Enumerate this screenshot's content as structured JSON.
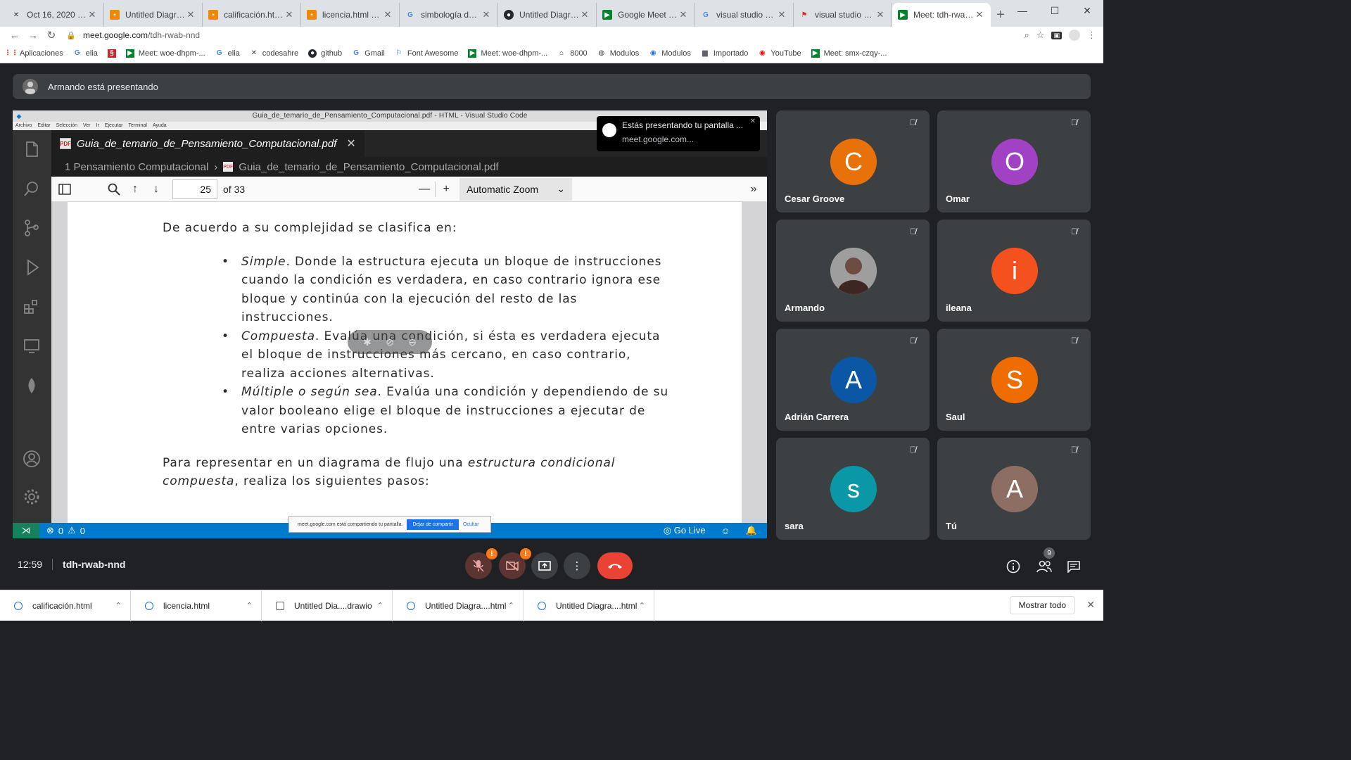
{
  "browser": {
    "tabs": [
      {
        "label": "Oct 16, 2020 - Co",
        "icon": "codesandbox-icon"
      },
      {
        "label": "Untitled Diagram.d",
        "icon": "drawio-icon"
      },
      {
        "label": "calificación.html -",
        "icon": "drawio-icon"
      },
      {
        "label": "licencia.html - diag",
        "icon": "drawio-icon"
      },
      {
        "label": "simbología de diag",
        "icon": "google-icon"
      },
      {
        "label": "Untitled Diagram.d",
        "icon": "github-icon"
      },
      {
        "label": "Google Meet (ante",
        "icon": "meet-icon"
      },
      {
        "label": "visual studio code",
        "icon": "google-icon"
      },
      {
        "label": "visual studio - Una",
        "icon": "bookmark-icon"
      },
      {
        "label": "Meet: tdh-rwab-nn",
        "icon": "meet-icon"
      }
    ],
    "url_host": "meet.google.com",
    "url_path": "/tdh-rwab-nnd",
    "bookmarks": [
      {
        "label": "Aplicaciones",
        "icon": "apps-grid-icon"
      },
      {
        "label": "elia",
        "icon": "google-icon"
      },
      {
        "label": "",
        "icon": "gov-icon"
      },
      {
        "label": "Meet: woe-dhpm-...",
        "icon": "meet-icon"
      },
      {
        "label": "elia",
        "icon": "google-icon"
      },
      {
        "label": "codesahre",
        "icon": "codeshare-icon"
      },
      {
        "label": "github",
        "icon": "github-icon"
      },
      {
        "label": "Gmail",
        "icon": "google-icon"
      },
      {
        "label": "Font Awesome",
        "icon": "flag-icon"
      },
      {
        "label": "Meet: woe-dhpm-...",
        "icon": "meet-icon"
      },
      {
        "label": "8000",
        "icon": "home-icon"
      },
      {
        "label": "Modulos",
        "icon": "globe-icon"
      },
      {
        "label": "Modulos",
        "icon": "edge-icon"
      },
      {
        "label": "Importado",
        "icon": "folder-icon"
      },
      {
        "label": "YouTube",
        "icon": "youtube-icon"
      },
      {
        "label": "Meet: smx-czqy-...",
        "icon": "meet-icon"
      }
    ]
  },
  "meet": {
    "presenter_text": "Armando está presentando",
    "time": "12:59",
    "meeting_code": "tdh-rwab-nnd",
    "participant_count": "9",
    "popup_line1": "Estás presentando tu pantalla ...",
    "popup_line2": "meet.google.com...",
    "participants": [
      {
        "name": "Cesar Groove",
        "initial": "C",
        "color": "#e8710a"
      },
      {
        "name": "Omar",
        "initial": "O",
        "color": "#a142c4"
      },
      {
        "name": "Armando",
        "initial": "",
        "color": "#7a7a7a"
      },
      {
        "name": "ileana",
        "initial": "i",
        "color": "#f4511e"
      },
      {
        "name": "Adrián Carrera",
        "initial": "A",
        "color": "#0b57a6"
      },
      {
        "name": "Saul",
        "initial": "S",
        "color": "#ef6c00"
      },
      {
        "name": "sara",
        "initial": "s",
        "color": "#0a97a6"
      },
      {
        "name": "Tú",
        "initial": "A",
        "color": "#8d6e63"
      }
    ]
  },
  "vscode": {
    "window_title": "Guia_de_temario_de_Pensamiento_Computacional.pdf - HTML - Visual Studio Code",
    "menu": [
      "Archivo",
      "Editar",
      "Selección",
      "Ver",
      "Ir",
      "Ejecutar",
      "Terminal",
      "Ayuda"
    ],
    "tab_label": "Guia_de_temario_de_Pensamiento_Computacional.pdf",
    "breadcrumb_folder": "1 Pensamiento Computacional",
    "breadcrumb_file": "Guia_de_temario_de_Pensamiento_Computacional.pdf",
    "page_current": "25",
    "page_total": "of 33",
    "zoom": "Automatic Zoom",
    "status_errors": "0",
    "status_warnings": "0",
    "go_live": "Go Live",
    "share_notice": "meet.google.com está compartiendo tu pantalla.",
    "share_stop": "Dejar de compartir",
    "share_hide": "Ocultar"
  },
  "pdf": {
    "intro": "De acuerdo a su complejidad se clasifica en:",
    "items": [
      {
        "term": "Simple",
        "text": ". Donde la estructura ejecuta un bloque de instrucciones cuando la condición es verdadera, en caso contrario ignora ese bloque y continúa con la ejecución del resto de las instrucciones."
      },
      {
        "term": "Compuesta",
        "text": ". Evalúa una condición, si ésta es verdadera ejecuta el bloque de instrucciones más cercano, en caso contrario, realiza acciones alternativas."
      },
      {
        "term": "Múltiple o según sea",
        "text": ". Evalúa una condición y dependiendo de su valor booleano elige el bloque de instrucciones a ejecutar de entre varias opciones."
      }
    ],
    "p2_start": "Para representar en un diagrama de flujo una ",
    "p2_em": "estructura condicional compuesta",
    "p2_end": ", realiza los siguientes pasos:"
  },
  "downloads": {
    "items": [
      {
        "label": "calificación.html"
      },
      {
        "label": "licencia.html"
      },
      {
        "label": "Untitled Dia....drawio"
      },
      {
        "label": "Untitled Diagra....html"
      },
      {
        "label": "Untitled Diagra....html"
      }
    ],
    "show_all": "Mostrar todo"
  }
}
